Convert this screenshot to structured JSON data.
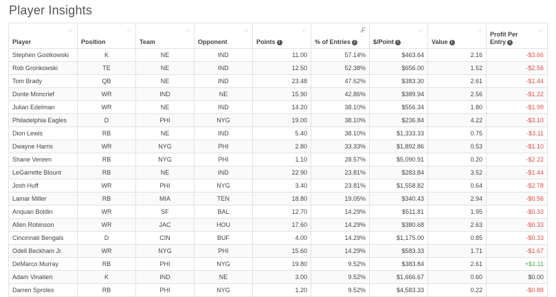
{
  "page_title": "Player Insights",
  "headers": {
    "player": "Player",
    "position": "Position",
    "team": "Team",
    "opponent": "Opponent",
    "points": "Points",
    "entries": "% of Entries",
    "per_point": "$/Point",
    "value": "Value",
    "profit_line1": "Profit Per",
    "profit_line2": "Entry"
  },
  "rows": [
    {
      "player": "Stephen Gostkowski",
      "pos": "K",
      "team": "NE",
      "opp": "IND",
      "points": "11.00",
      "entries": "57.14%",
      "per_point": "$463.64",
      "value": "2.16",
      "profit": "-$3.66",
      "sign": "neg"
    },
    {
      "player": "Rob Gronkowski",
      "pos": "TE",
      "team": "NE",
      "opp": "IND",
      "points": "12.50",
      "entries": "52.38%",
      "per_point": "$656.00",
      "value": "1.52",
      "profit": "-$2.56",
      "sign": "neg"
    },
    {
      "player": "Tom Brady",
      "pos": "QB",
      "team": "NE",
      "opp": "IND",
      "points": "23.48",
      "entries": "47.62%",
      "per_point": "$383.30",
      "value": "2.61",
      "profit": "-$1.44",
      "sign": "neg"
    },
    {
      "player": "Donte Moncrief",
      "pos": "WR",
      "team": "IND",
      "opp": "NE",
      "points": "15.90",
      "entries": "42.86%",
      "per_point": "$389.94",
      "value": "2.56",
      "profit": "-$1.22",
      "sign": "neg"
    },
    {
      "player": "Julian Edelman",
      "pos": "WR",
      "team": "NE",
      "opp": "IND",
      "points": "14.20",
      "entries": "38.10%",
      "per_point": "$556.34",
      "value": "1.80",
      "profit": "-$1.99",
      "sign": "neg"
    },
    {
      "player": "Philadelphia Eagles",
      "pos": "D",
      "team": "PHI",
      "opp": "NYG",
      "points": "19.00",
      "entries": "38.10%",
      "per_point": "$236.84",
      "value": "4.22",
      "profit": "-$3.10",
      "sign": "neg"
    },
    {
      "player": "Dion Lewis",
      "pos": "RB",
      "team": "NE",
      "opp": "IND",
      "points": "5.40",
      "entries": "38.10%",
      "per_point": "$1,333.33",
      "value": "0.75",
      "profit": "-$3.11",
      "sign": "neg"
    },
    {
      "player": "Dwayne Harris",
      "pos": "WR",
      "team": "NYG",
      "opp": "PHI",
      "points": "2.80",
      "entries": "33.33%",
      "per_point": "$1,892.86",
      "value": "0.53",
      "profit": "-$1.10",
      "sign": "neg"
    },
    {
      "player": "Shane Vereen",
      "pos": "RB",
      "team": "NYG",
      "opp": "PHI",
      "points": "1.10",
      "entries": "28.57%",
      "per_point": "$5,090.91",
      "value": "0.20",
      "profit": "-$2.22",
      "sign": "neg"
    },
    {
      "player": "LeGarrette Blount",
      "pos": "RB",
      "team": "NE",
      "opp": "IND",
      "points": "22.90",
      "entries": "23.81%",
      "per_point": "$283.84",
      "value": "3.52",
      "profit": "-$1.44",
      "sign": "neg"
    },
    {
      "player": "Josh Huff",
      "pos": "WR",
      "team": "PHI",
      "opp": "NYG",
      "points": "3.40",
      "entries": "23.81%",
      "per_point": "$1,558.82",
      "value": "0.64",
      "profit": "-$2.78",
      "sign": "neg"
    },
    {
      "player": "Lamar Miller",
      "pos": "RB",
      "team": "MIA",
      "opp": "TEN",
      "points": "18.80",
      "entries": "19.05%",
      "per_point": "$340.43",
      "value": "2.94",
      "profit": "-$0.56",
      "sign": "neg"
    },
    {
      "player": "Anquan Boldin",
      "pos": "WR",
      "team": "SF",
      "opp": "BAL",
      "points": "12.70",
      "entries": "14.29%",
      "per_point": "$511.81",
      "value": "1.95",
      "profit": "-$0.33",
      "sign": "neg"
    },
    {
      "player": "Allen Robinson",
      "pos": "WR",
      "team": "JAC",
      "opp": "HOU",
      "points": "17.60",
      "entries": "14.29%",
      "per_point": "$380.68",
      "value": "2.63",
      "profit": "-$0.33",
      "sign": "neg"
    },
    {
      "player": "Cincinnati Bengals",
      "pos": "D",
      "team": "CIN",
      "opp": "BUF",
      "points": "4.00",
      "entries": "14.29%",
      "per_point": "$1,175.00",
      "value": "0.85",
      "profit": "-$0.33",
      "sign": "neg"
    },
    {
      "player": "Odell Beckham Jr.",
      "pos": "WR",
      "team": "NYG",
      "opp": "PHI",
      "points": "15.60",
      "entries": "14.29%",
      "per_point": "$583.33",
      "value": "1.71",
      "profit": "-$1.67",
      "sign": "neg"
    },
    {
      "player": "DeMarco Murray",
      "pos": "RB",
      "team": "PHI",
      "opp": "NYG",
      "points": "19.80",
      "entries": "9.52%",
      "per_point": "$383.84",
      "value": "2.61",
      "profit": "+$1.11",
      "sign": "pos"
    },
    {
      "player": "Adam Vinatieri",
      "pos": "K",
      "team": "IND",
      "opp": "NE",
      "points": "3.00",
      "entries": "9.52%",
      "per_point": "$1,666.67",
      "value": "0.60",
      "profit": "$0.00",
      "sign": "zero"
    },
    {
      "player": "Darren Sproles",
      "pos": "RB",
      "team": "PHI",
      "opp": "NYG",
      "points": "1.20",
      "entries": "9.52%",
      "per_point": "$4,583.33",
      "value": "0.22",
      "profit": "-$0.88",
      "sign": "neg"
    }
  ],
  "colors": {
    "negative": "#d9534f",
    "positive": "#4cae4c",
    "border": "#e2e2e2",
    "title": "#555555"
  }
}
